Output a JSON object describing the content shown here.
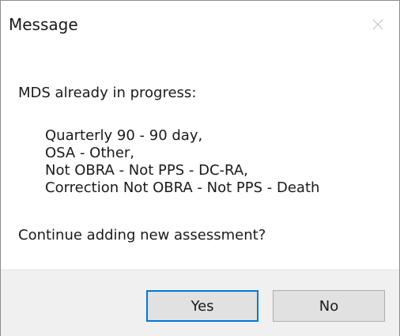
{
  "window": {
    "title": "Message",
    "close_icon": "close-icon"
  },
  "message": {
    "intro": "MDS already in progress:",
    "items": [
      "Quarterly 90 - 90 day,",
      "OSA - Other,",
      "Not OBRA - Not PPS - DC-RA,",
      "Correction Not OBRA - Not PPS - Death"
    ],
    "question": "Continue adding new assessment?"
  },
  "buttons": {
    "yes_label": "Yes",
    "no_label": "No"
  },
  "colors": {
    "accent": "#0078d7",
    "footer_bg": "#f0f0f0",
    "button_bg": "#e1e1e1"
  }
}
